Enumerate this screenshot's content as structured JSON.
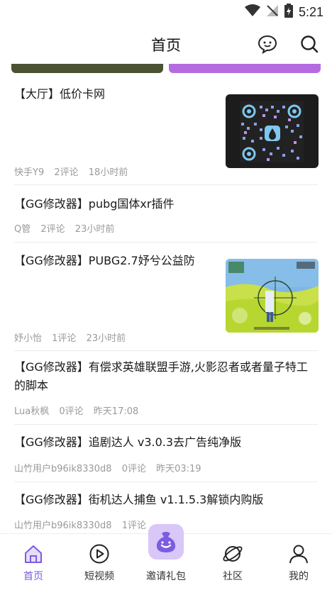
{
  "status_bar": {
    "time": "5:21"
  },
  "header": {
    "title": "首页"
  },
  "banners": {
    "left_color": "#4a5233",
    "right_color": "#b46be0"
  },
  "posts": [
    {
      "title": "【大厅】低价卡网",
      "author": "快手Y9",
      "comments": "2评论",
      "time": "18小时前",
      "thumbnail": "qr-code"
    },
    {
      "title": "【GG修改器】pubg国体xr插件",
      "author": "Q管",
      "comments": "2评论",
      "time": "23小时前"
    },
    {
      "title": "【GG修改器】PUBG2.7妤兮公益防",
      "author": "妤小怡",
      "comments": "1评论",
      "time": "23小时前",
      "thumbnail": "game-screenshot"
    },
    {
      "title": "【GG修改器】有偿求英雄联盟手游,火影忍者或者量子特工的脚本",
      "author": "Lua秋枫",
      "comments": "0评论",
      "time": "昨天17:08"
    },
    {
      "title": "【GG修改器】追剧达人 v3.0.3去广告纯净版",
      "author": "山竹用户b96ik8330d8",
      "comments": "0评论",
      "time": "昨天03:19"
    },
    {
      "title": "【GG修改器】街机达人捕鱼 v1.1.5.3解锁内购版",
      "author": "山竹用户b96ik8330d8",
      "comments": "1评论",
      "time": ""
    }
  ],
  "tabs": [
    {
      "label": "首页",
      "icon": "home-icon",
      "active": true
    },
    {
      "label": "短视频",
      "icon": "play-icon"
    },
    {
      "label": "邀请礼包",
      "icon": "gift-bag-icon"
    },
    {
      "label": "社区",
      "icon": "planet-icon"
    },
    {
      "label": "我的",
      "icon": "user-icon"
    }
  ],
  "colors": {
    "accent": "#7c5ce0",
    "meta_text": "#9a9a9a"
  }
}
